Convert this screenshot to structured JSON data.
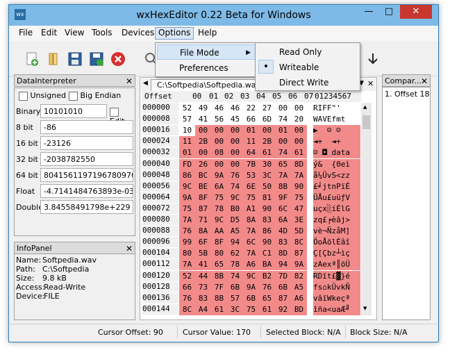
{
  "window": {
    "title": "wxHexEditor 0.22 Beta for Windows",
    "icon_text": "wx"
  },
  "window_buttons": {
    "minimize": "—",
    "maximize": "□",
    "close": "✕"
  },
  "menubar": {
    "items": [
      "File",
      "Edit",
      "View",
      "Tools",
      "Devices",
      "Options",
      "Help"
    ],
    "active": "Options"
  },
  "options_menu": {
    "items": [
      "File Mode",
      "Preferences"
    ],
    "submenu_arrow": "▶"
  },
  "file_mode_submenu": {
    "items": [
      "Read Only",
      "Writeable",
      "Direct Write"
    ],
    "selected": "Writeable",
    "radio_mark": "•"
  },
  "data_interpreter": {
    "title": "DataInterpreter",
    "close": "✕",
    "unsigned_label": "Unsigned",
    "big_endian_label": "Big Endian",
    "edit_label": "Edit",
    "rows": [
      {
        "label": "Binary",
        "value": "10101010"
      },
      {
        "label": "8 bit",
        "value": "-86"
      },
      {
        "label": "16 bit",
        "value": "-23126"
      },
      {
        "label": "32 bit",
        "value": "-2038782550"
      },
      {
        "label": "64 bit",
        "value": "8041561197196780970"
      },
      {
        "label": "Float",
        "value": "-4.7141484763893e-035"
      },
      {
        "label": "Double",
        "value": "3.84558491798e+229"
      }
    ]
  },
  "info_panel": {
    "title": "InfoPanel",
    "close": "✕",
    "rows": [
      {
        "label": "Name:",
        "value": "Softpedia.wav"
      },
      {
        "label": "Path:",
        "value": "C:\\Softpedia"
      },
      {
        "label": "Size:",
        "value": "9.8 kB"
      },
      {
        "label": "Access:",
        "value": "Read-Write"
      },
      {
        "label": "Device:",
        "value": "FILE"
      }
    ]
  },
  "editor_tab": {
    "label": "C:\\Softpedia\\Softpedia.wav",
    "nav_left": "◀",
    "nav_right": "▶",
    "dropdown": "▼",
    "close": "✕"
  },
  "hex_header": {
    "offset_label": "Offset",
    "columns": [
      "00",
      "01",
      "02",
      "03",
      "04",
      "05",
      "06",
      "07"
    ],
    "ascii_header": "01234567"
  },
  "hex_rows": [
    {
      "offset": "000000",
      "bytes": [
        "52",
        "49",
        "46",
        "46",
        "22",
        "27",
        "00",
        "00"
      ],
      "ascii": "RIFF\"'"
    },
    {
      "offset": "000008",
      "bytes": [
        "57",
        "41",
        "56",
        "45",
        "66",
        "6D",
        "74",
        "20"
      ],
      "ascii": "WAVEfmt"
    },
    {
      "offset": "000016",
      "bytes": [
        "10",
        "00",
        "00",
        "00",
        "01",
        "00",
        "01",
        "00"
      ],
      "ascii": "▶  ☺ ☺"
    },
    {
      "offset": "000024",
      "bytes": [
        "11",
        "2B",
        "00",
        "00",
        "11",
        "2B",
        "00",
        "00"
      ],
      "ascii": "◄+  ◄+"
    },
    {
      "offset": "000032",
      "bytes": [
        "01",
        "00",
        "08",
        "00",
        "64",
        "61",
        "74",
        "61"
      ],
      "ascii": "☺ ◘ data"
    },
    {
      "offset": "000040",
      "bytes": [
        "FD",
        "26",
        "00",
        "00",
        "7B",
        "30",
        "65",
        "8D"
      ],
      "ascii": "ý&  {0eì"
    },
    {
      "offset": "000048",
      "bytes": [
        "86",
        "BC",
        "9A",
        "76",
        "53",
        "3C",
        "7A",
        "7A"
      ],
      "ascii": "å¼ÜvS<zz"
    },
    {
      "offset": "000056",
      "bytes": [
        "9C",
        "BE",
        "6A",
        "74",
        "6E",
        "50",
        "8B",
        "90"
      ],
      "ascii": "£╛jtnPïÉ"
    },
    {
      "offset": "000064",
      "bytes": [
        "9A",
        "8F",
        "75",
        "9C",
        "75",
        "81",
        "9F",
        "75"
      ],
      "ascii": "ÜÅu£uüƒV"
    },
    {
      "offset": "000072",
      "bytes": [
        "75",
        "87",
        "78",
        "B0",
        "A1",
        "90",
        "6C",
        "47"
      ],
      "ascii": "uçx░íÉlG"
    },
    {
      "offset": "000080",
      "bytes": [
        "7A",
        "71",
        "9C",
        "D5",
        "8A",
        "83",
        "6A",
        "3E"
      ],
      "ascii": "zq£╒èâj>"
    },
    {
      "offset": "000088",
      "bytes": [
        "76",
        "8A",
        "AA",
        "A5",
        "7A",
        "86",
        "4D",
        "5D"
      ],
      "ascii": "vè¬ÑzåM]"
    },
    {
      "offset": "000096",
      "bytes": [
        "99",
        "6F",
        "8F",
        "94",
        "6C",
        "90",
        "83",
        "8C"
      ],
      "ascii": "ÖoÅölÉâî"
    },
    {
      "offset": "000104",
      "bytes": [
        "80",
        "5B",
        "80",
        "62",
        "7A",
        "C1",
        "8D",
        "87"
      ],
      "ascii": "Ç[Çbz┴ìç"
    },
    {
      "offset": "000112",
      "bytes": [
        "7A",
        "41",
        "65",
        "78",
        "A6",
        "BA",
        "94",
        "9A"
      ],
      "ascii": "zAexª║öÜ"
    },
    {
      "offset": "000120",
      "bytes": [
        "52",
        "44",
        "8B",
        "74",
        "9C",
        "B2",
        "7D",
        "82"
      ],
      "ascii": "RDït£▓}é"
    },
    {
      "offset": "000128",
      "bytes": [
        "66",
        "73",
        "7F",
        "6B",
        "9A",
        "76",
        "6B",
        "A5"
      ],
      "ascii": "fs⌂kÜvkÑ"
    },
    {
      "offset": "000136",
      "bytes": [
        "76",
        "83",
        "8B",
        "57",
        "6B",
        "65",
        "87",
        "A6"
      ],
      "ascii": "vâïWkeçª"
    },
    {
      "offset": "000144",
      "bytes": [
        "8C",
        "A4",
        "61",
        "3C",
        "75",
        "61",
        "92",
        "BD"
      ],
      "ascii": "îña<uaÆ╜"
    }
  ],
  "compare_panel": {
    "title": "Compar...",
    "close": "✕",
    "items": [
      "1. Offset 18"
    ]
  },
  "status_bar": {
    "cursor_offset": "Cursor Offset: 90",
    "cursor_value": "Cursor Value: 170",
    "selected_block": "Selected Block: N/A",
    "block_size": "Block Size: N/A"
  },
  "colors": {
    "titlebar": "#7ebae7",
    "selection": "#f28a8a",
    "close_button": "#c7372f",
    "menu_highlight": "#d6e6f6"
  }
}
